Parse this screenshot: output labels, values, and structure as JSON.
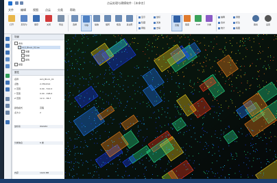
{
  "window": {
    "title": "点云处理与建模软件 - [未命名]",
    "colors": {
      "accent": "#1e6fd0",
      "ribbon_active": "#cfe0f5"
    }
  },
  "menu": [
    "文件",
    "编辑",
    "视图",
    "点云",
    "分类",
    "帮助"
  ],
  "ribbon": {
    "groups": [
      {
        "label": "打开"
      },
      {
        "label": "另存为"
      },
      {
        "label": "保存"
      },
      {
        "label": "关闭"
      },
      {
        "label": "导出"
      },
      {
        "label": "选择"
      },
      {
        "label": "平移"
      },
      {
        "label": "缩放"
      },
      {
        "label": "旋转"
      },
      {
        "label": "框选"
      },
      {
        "label": "多边形"
      },
      {
        "label": "高程"
      },
      {
        "label": "强度"
      },
      {
        "label": "RGB"
      },
      {
        "label": "分类"
      },
      {
        "label": "裁剪"
      },
      {
        "label": "设置"
      }
    ],
    "small_items": [
      "显示",
      "隐藏",
      "网格",
      "坐标",
      "滤波",
      "去噪",
      "抽稀",
      "合并",
      "统计",
      "测量",
      "标注",
      "截图"
    ]
  },
  "scene_panel": {
    "title": "场景",
    "items": [
      {
        "label": "点云",
        "level": 0
      },
      {
        "label": "ALS_Block_01.las",
        "level": 1,
        "selected": true
      },
      {
        "label": "地面",
        "level": 2
      },
      {
        "label": "植被",
        "level": 2
      },
      {
        "label": "建筑",
        "level": 2
      },
      {
        "label": "模型",
        "level": 0
      }
    ]
  },
  "props_panel": {
    "title": "属性",
    "rows": [
      {
        "k": "名称",
        "v": "ALS_Block_01"
      },
      {
        "k": "点数",
        "v": "2,356,814"
      },
      {
        "k": "X 范围",
        "v": "0.00 - 512.0"
      },
      {
        "k": "Y 范围",
        "v": "0.00 - 498.6"
      },
      {
        "k": "Z 范围",
        "v": "12.4 - 86.7"
      },
      {
        "k": "颜色模式",
        "v": "高程"
      },
      {
        "k": "点大小",
        "v": "2"
      }
    ],
    "categories": [
      {
        "label": "坐标系",
        "v": "WGS84"
      },
      {
        "label": "分类信息",
        "v": "6 类"
      },
      {
        "label": "内存",
        "v": "1024 MB"
      }
    ]
  }
}
